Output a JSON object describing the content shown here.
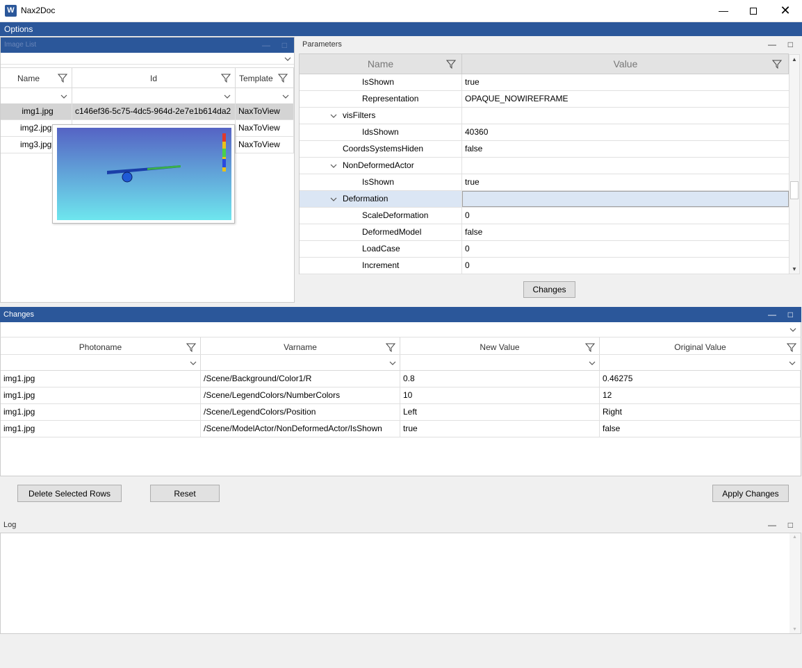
{
  "window": {
    "title": "Nax2Doc",
    "app_icon_letter": "W"
  },
  "menu": {
    "options": "Options"
  },
  "image_list": {
    "title": "Image List",
    "columns": [
      "Name",
      "Id",
      "Template"
    ],
    "rows": [
      {
        "name": "img1.jpg",
        "id": "c146ef36-5c75-4dc5-964d-2e7e1b614da2",
        "template": "NaxToView"
      },
      {
        "name": "img2.jpg",
        "id": "",
        "template": "NaxToView"
      },
      {
        "name": "img3.jpg",
        "id": "",
        "template": "NaxToView"
      }
    ]
  },
  "parameters": {
    "title": "Parameters",
    "columns": [
      "Name",
      "Value"
    ],
    "rows": [
      {
        "name": "IsShown",
        "value": "true",
        "indent": 2,
        "expander": false
      },
      {
        "name": "Representation",
        "value": "OPAQUE_NOWIREFRAME",
        "indent": 2,
        "expander": false
      },
      {
        "name": "visFilters",
        "value": "",
        "indent": 1,
        "expander": true
      },
      {
        "name": "IdsShown",
        "value": "40360",
        "indent": 2,
        "expander": false
      },
      {
        "name": "CoordsSystemsHiden",
        "value": "false",
        "indent": 1,
        "expander": false
      },
      {
        "name": "NonDeformedActor",
        "value": "",
        "indent": 1,
        "expander": true
      },
      {
        "name": "IsShown",
        "value": "true",
        "indent": 2,
        "expander": false
      },
      {
        "name": "Deformation",
        "value": "",
        "indent": 1,
        "expander": true
      },
      {
        "name": "ScaleDeformation",
        "value": "0",
        "indent": 2,
        "expander": false
      },
      {
        "name": "DeformedModel",
        "value": "false",
        "indent": 2,
        "expander": false
      },
      {
        "name": "LoadCase",
        "value": "0",
        "indent": 2,
        "expander": false
      },
      {
        "name": "Increment",
        "value": "0",
        "indent": 2,
        "expander": false
      }
    ],
    "changes_button": "Changes"
  },
  "changes": {
    "title": "Changes",
    "columns": [
      "Photoname",
      "Varname",
      "New Value",
      "Original Value"
    ],
    "rows": [
      {
        "photoname": "img1.jpg",
        "varname": "/Scene/Background/Color1/R",
        "new_value": "0.8",
        "original_value": "0.46275"
      },
      {
        "photoname": "img1.jpg",
        "varname": "/Scene/LegendColors/NumberColors",
        "new_value": "10",
        "original_value": "12"
      },
      {
        "photoname": "img1.jpg",
        "varname": "/Scene/LegendColors/Position",
        "new_value": "Left",
        "original_value": "Right"
      },
      {
        "photoname": "img1.jpg",
        "varname": "/Scene/ModelActor/NonDeformedActor/IsShown",
        "new_value": "true",
        "original_value": "false"
      }
    ],
    "delete_button": "Delete Selected Rows",
    "reset_button": "Reset",
    "apply_button": "Apply Changes"
  },
  "log": {
    "title": "Log"
  },
  "colors": {
    "accent": "#2b579a",
    "selection": "#d4d4d4",
    "row_highlight": "#dbe6f4"
  },
  "icons": {
    "minimize": "pane-minimize-icon",
    "maximize": "pane-maximize-icon",
    "filter": "filter-icon",
    "chevron": "chevron-down-icon"
  }
}
